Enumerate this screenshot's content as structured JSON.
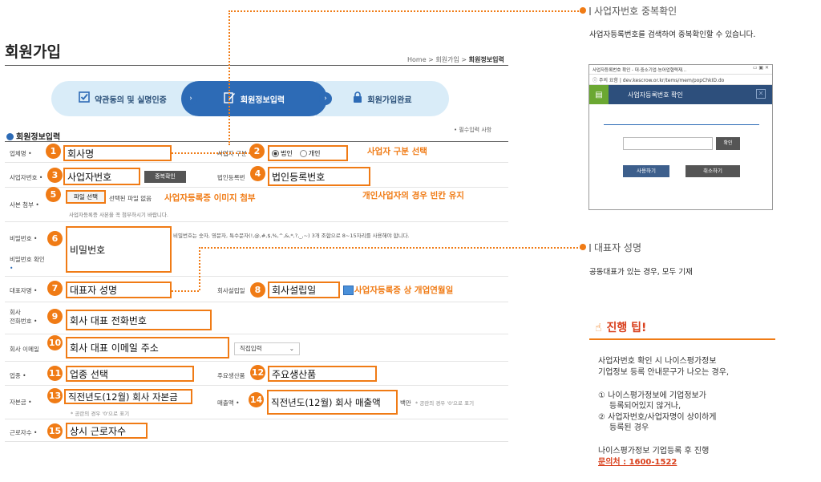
{
  "page_title": "회원가입",
  "breadcrumb": {
    "home": "Home",
    "sep": ">",
    "join": "회원가입",
    "current": "회원정보입력"
  },
  "steps": [
    {
      "label": "약관동의 및 실명인증",
      "icon": "check-square-icon"
    },
    {
      "label": "회원정보입력",
      "icon": "edit-icon"
    },
    {
      "label": "회원가입완료",
      "icon": "lock-icon"
    }
  ],
  "section_title": "회원정보입력",
  "required_note": "• 필수입력 사항",
  "labels": {
    "company": "업체명 •",
    "biz_type": "사업자 구분",
    "biz_no": "사업자번호 •",
    "corp_no": "법인등록번",
    "attach": "사본 첨부 •",
    "password": "비밀번호 •",
    "password_confirm": "비밀번호 확인",
    "password_confirm_req": "•",
    "ceo": "대표자명 •",
    "founded": "회사설립일",
    "phone_l1": "회사",
    "phone_l2": "전화번호 •",
    "email": "회사 이메일",
    "industry": "업종 •",
    "product": "주요생산품",
    "capital": "자본금 •",
    "sales": "매출액 •",
    "employees": "근로자수 •"
  },
  "fields": {
    "company": "회사명",
    "biz_no": "사업자번호",
    "corp_no": "법인등록번호",
    "password": "비밀번호",
    "ceo": "대표자 성명",
    "founded": "회사설립일",
    "phone": "회사 대표 전화번호",
    "email": "회사 대표 이메일 주소",
    "industry": "업종 선택",
    "product": "주요생산품",
    "capital": "직전년도(12월) 회사 자본금",
    "sales": "직전년도(12월) 회사 매출액",
    "employees": "상시 근로자수"
  },
  "numbers": [
    "1",
    "2",
    "3",
    "4",
    "5",
    "6",
    "7",
    "8",
    "9",
    "10",
    "11",
    "12",
    "13",
    "14",
    "15"
  ],
  "radio": {
    "corp": "법인",
    "individual": "개인"
  },
  "buttons": {
    "dup_check": "중복확인",
    "file_select": "파일 선택"
  },
  "file_status": "선택된 파일 없음",
  "attach_note": "사업자등록증 사본을 꼭 첨부하시기 바랍니다.",
  "password_note": "비밀번호는 숫자, 영문자, 특수문자(!,@,#,$,%,^,&,*,?,_,~) 3개 조합으로 8~15자리를 사용해야 합니다.",
  "email_select": "직접입력",
  "sales_unit": "백만",
  "public_note": "* 공란의 경우 '0'으로 표기",
  "hints": {
    "biz_type": "사업자 구분 선택",
    "attach": "사업자등록증 이미지 첨부",
    "individual": "개인사업자의 경우 빈칸 유지",
    "founded": "사업자등록증 상 개업연월일"
  },
  "right": {
    "dup_title": "사업자번호 중복확인",
    "dup_desc": "사업자등록번호를 검색하여 중복확인할 수 있습니다.",
    "ceo_title": "대표자 성명",
    "ceo_desc": "공동대표가 있는 경우, 모두 기재",
    "tip_title": "진행 팁!",
    "tip_l1": "사업자번호 확인 시 나이스평가정보",
    "tip_l2": "기업정보 등록 안내문구가 나오는 경우,",
    "tip_l3": "① 나이스평가정보에 기업정보가",
    "tip_l4": "등록되어있지 않거나,",
    "tip_l5": "② 사업자번호/사업자명이 상이하게",
    "tip_l6": "등록된 경우",
    "tip_l7": "나이스평가정보 기업등록 후 진행",
    "tip_contact": "문의처 : 1600-1522"
  },
  "popup": {
    "window_title": "사업자등록번호 확인 - 대·중소기업·농어업협력재...",
    "address": "dev.kescrow.or.kr/tems/mem/popChkID.do",
    "addr_prefix": "주의 요함",
    "header": "사업자등록번호 확인",
    "confirm": "확인",
    "use": "사용하기",
    "cancel": "취소하기"
  },
  "colors": {
    "accent": "#f07b15",
    "primary": "#2d6bb6",
    "popup_header": "#2d4f7c"
  }
}
